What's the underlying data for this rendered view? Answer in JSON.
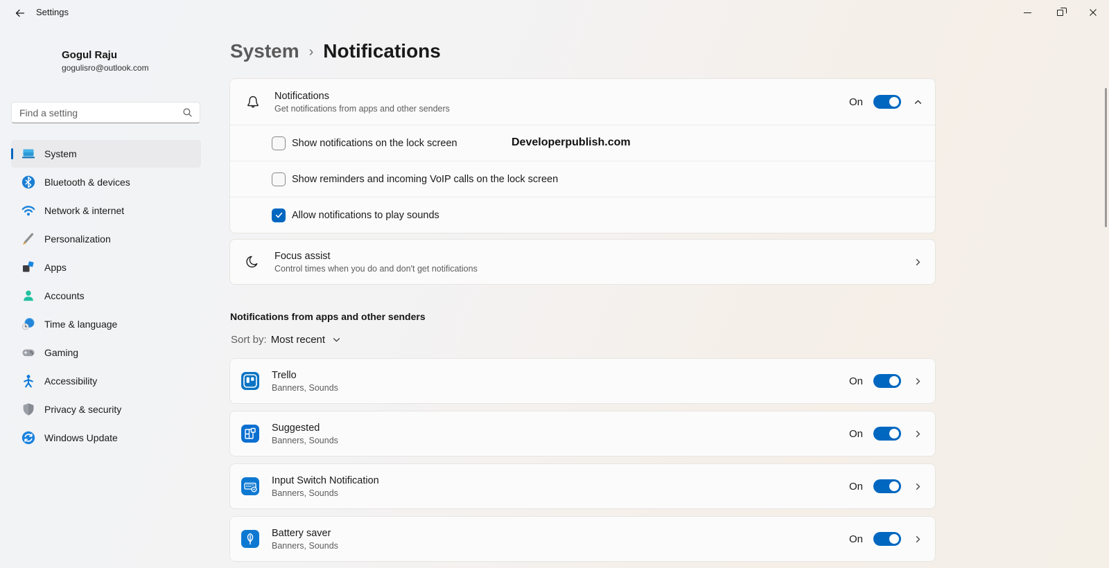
{
  "titlebar": {
    "app_title": "Settings"
  },
  "window_controls": {
    "minimize": "minimize",
    "restore": "restore",
    "close": "close"
  },
  "sidebar": {
    "user": {
      "name": "Gogul Raju",
      "email": "gogulisro@outlook.com"
    },
    "search": {
      "placeholder": "Find a setting"
    },
    "items": [
      {
        "label": "System",
        "icon": "system-icon",
        "selected": true
      },
      {
        "label": "Bluetooth & devices",
        "icon": "bluetooth-icon",
        "selected": false
      },
      {
        "label": "Network & internet",
        "icon": "network-icon",
        "selected": false
      },
      {
        "label": "Personalization",
        "icon": "personalization-icon",
        "selected": false
      },
      {
        "label": "Apps",
        "icon": "apps-icon",
        "selected": false
      },
      {
        "label": "Accounts",
        "icon": "accounts-icon",
        "selected": false
      },
      {
        "label": "Time & language",
        "icon": "time-language-icon",
        "selected": false
      },
      {
        "label": "Gaming",
        "icon": "gaming-icon",
        "selected": false
      },
      {
        "label": "Accessibility",
        "icon": "accessibility-icon",
        "selected": false
      },
      {
        "label": "Privacy & security",
        "icon": "privacy-security-icon",
        "selected": false
      },
      {
        "label": "Windows Update",
        "icon": "windows-update-icon",
        "selected": false
      }
    ]
  },
  "main": {
    "breadcrumb": {
      "parent": "System",
      "separator": "›",
      "current": "Notifications"
    },
    "notifications_card": {
      "icon": "bell-icon",
      "title": "Notifications",
      "subtitle": "Get notifications from apps and other senders",
      "toggle_label": "On",
      "toggle_state": true,
      "expanded": true,
      "options": [
        {
          "label": "Show notifications on the lock screen",
          "checked": false,
          "watermark": "Developerpublish.com"
        },
        {
          "label": "Show reminders and incoming VoIP calls on the lock screen",
          "checked": false
        },
        {
          "label": "Allow notifications to play sounds",
          "checked": true
        }
      ]
    },
    "focus_assist_card": {
      "icon": "moon-icon",
      "title": "Focus assist",
      "subtitle": "Control times when you do and don't get notifications"
    },
    "apps_section": {
      "heading": "Notifications from apps and other senders",
      "sort_label": "Sort by:",
      "sort_value": "Most recent",
      "apps": [
        {
          "name": "Trello",
          "detail": "Banners, Sounds",
          "icon": "trello-icon",
          "toggle_label": "On",
          "toggle_state": true
        },
        {
          "name": "Suggested",
          "detail": "Banners, Sounds",
          "icon": "suggested-icon",
          "toggle_label": "On",
          "toggle_state": true
        },
        {
          "name": "Input Switch Notification",
          "detail": "Banners, Sounds",
          "icon": "input-switch-icon",
          "toggle_label": "On",
          "toggle_state": true
        },
        {
          "name": "Battery saver",
          "detail": "Banners, Sounds",
          "icon": "battery-saver-icon",
          "toggle_label": "On",
          "toggle_state": true
        }
      ]
    }
  },
  "colors": {
    "accent": "#0067C0",
    "card_bg": "#fbfbfb",
    "text_secondary": "#5d5d5d"
  }
}
